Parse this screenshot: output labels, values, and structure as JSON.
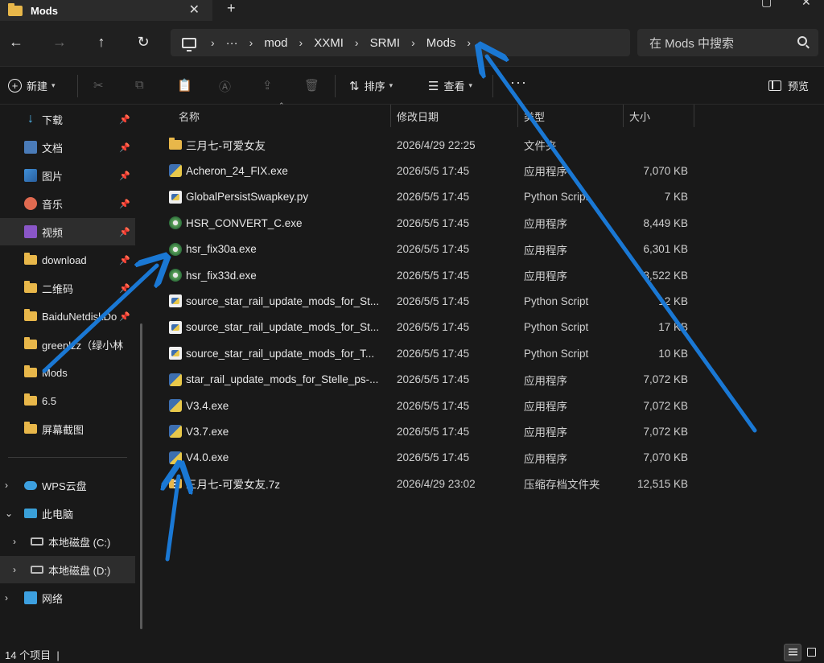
{
  "window": {
    "tab_title": "Mods",
    "tab_close": "✕",
    "new_tab": "+"
  },
  "nav": {
    "back": "←",
    "forward": "→",
    "up": "↑",
    "refresh": "↻"
  },
  "breadcrumb": {
    "ellipsis": "···",
    "items": [
      "mod",
      "XXMI",
      "SRMI",
      "Mods"
    ],
    "separator": "›"
  },
  "search": {
    "placeholder": "在 Mods 中搜索"
  },
  "toolbar": {
    "new_label": "新建",
    "sort_label": "排序",
    "view_label": "查看",
    "more": "···",
    "preview_label": "预览"
  },
  "sidebar": {
    "quick_access": [
      {
        "label": "下载",
        "icon": "download-icon",
        "pinned": true
      },
      {
        "label": "文档",
        "icon": "documents-icon",
        "pinned": true
      },
      {
        "label": "图片",
        "icon": "pictures-icon",
        "pinned": true
      },
      {
        "label": "音乐",
        "icon": "music-icon",
        "pinned": true
      },
      {
        "label": "视频",
        "icon": "videos-icon",
        "pinned": true,
        "selected": true
      },
      {
        "label": "download",
        "icon": "folder-icon",
        "pinned": true
      },
      {
        "label": "二维码",
        "icon": "folder-icon",
        "pinned": true
      },
      {
        "label": "BaiduNetdiskDo",
        "icon": "folder-icon",
        "pinned": true
      },
      {
        "label": "greenlzz（绿小林",
        "icon": "folder-icon",
        "pinned": false
      },
      {
        "label": "Mods",
        "icon": "folder-icon",
        "pinned": false
      },
      {
        "label": "6.5",
        "icon": "folder-icon",
        "pinned": false
      },
      {
        "label": "屏幕截图",
        "icon": "folder-icon",
        "pinned": false
      }
    ],
    "tree": [
      {
        "label": "WPS云盘",
        "expanded": false
      },
      {
        "label": "此电脑",
        "expanded": true
      },
      {
        "label": "本地磁盘 (C:)",
        "expanded": false
      },
      {
        "label": "本地磁盘 (D:)",
        "expanded": false,
        "selected": true
      },
      {
        "label": "网络",
        "expanded": false
      }
    ]
  },
  "columns": {
    "name": "名称",
    "date": "修改日期",
    "type": "类型",
    "size": "大小"
  },
  "files": [
    {
      "name": "三月七-可爱女友",
      "date": "2026/4/29 22:25",
      "type": "文件夹",
      "size": "",
      "icon": "folder"
    },
    {
      "name": "Acheron_24_FIX.exe",
      "date": "2026/5/5 17:45",
      "type": "应用程序",
      "size": "7,070 KB",
      "icon": "exe-py"
    },
    {
      "name": "GlobalPersistSwapkey.py",
      "date": "2026/5/5 17:45",
      "type": "Python Script",
      "size": "7 KB",
      "icon": "py"
    },
    {
      "name": "HSR_CONVERT_C.exe",
      "date": "2026/5/5 17:45",
      "type": "应用程序",
      "size": "8,449 KB",
      "icon": "gear"
    },
    {
      "name": "hsr_fix30a.exe",
      "date": "2026/5/5 17:45",
      "type": "应用程序",
      "size": "6,301 KB",
      "icon": "gear"
    },
    {
      "name": "hsr_fix33d.exe",
      "date": "2026/5/5 17:45",
      "type": "应用程序",
      "size": "8,522 KB",
      "icon": "gear"
    },
    {
      "name": "source_star_rail_update_mods_for_St...",
      "date": "2026/5/5 17:45",
      "type": "Python Script",
      "size": "12 KB",
      "icon": "py"
    },
    {
      "name": "source_star_rail_update_mods_for_St...",
      "date": "2026/5/5 17:45",
      "type": "Python Script",
      "size": "17 KB",
      "icon": "py"
    },
    {
      "name": "source_star_rail_update_mods_for_T...",
      "date": "2026/5/5 17:45",
      "type": "Python Script",
      "size": "10 KB",
      "icon": "py"
    },
    {
      "name": "star_rail_update_mods_for_Stelle_ps-...",
      "date": "2026/5/5 17:45",
      "type": "应用程序",
      "size": "7,072 KB",
      "icon": "exe-py"
    },
    {
      "name": "V3.4.exe",
      "date": "2026/5/5 17:45",
      "type": "应用程序",
      "size": "7,072 KB",
      "icon": "exe-py"
    },
    {
      "name": "V3.7.exe",
      "date": "2026/5/5 17:45",
      "type": "应用程序",
      "size": "7,072 KB",
      "icon": "exe-py"
    },
    {
      "name": "V4.0.exe",
      "date": "2026/5/5 17:45",
      "type": "应用程序",
      "size": "7,070 KB",
      "icon": "exe-py"
    },
    {
      "name": "三月七-可爱女友.7z",
      "date": "2026/4/29 23:02",
      "type": "压缩存档文件夹",
      "size": "12,515 KB",
      "icon": "zip"
    }
  ],
  "status": {
    "item_count": "14 个项目",
    "divider": "|"
  },
  "colors": {
    "annotation_arrow": "#1a78d4",
    "background": "#191919",
    "folder": "#e8b74a"
  }
}
